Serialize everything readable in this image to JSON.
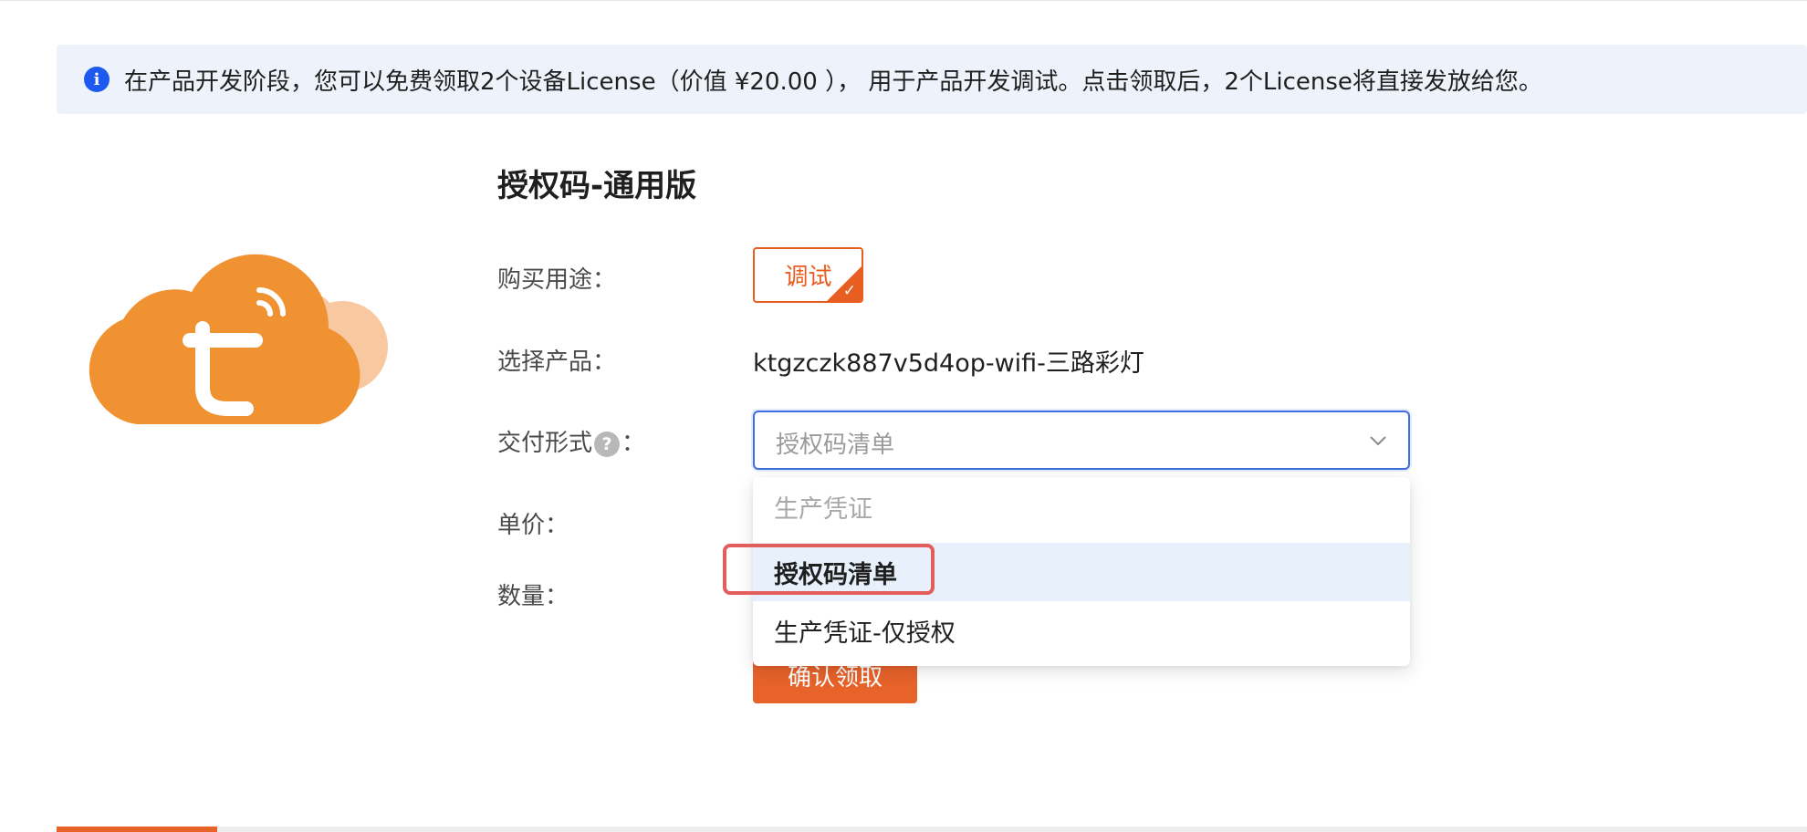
{
  "notice": {
    "icon": "info-icon",
    "text": "在产品开发阶段，您可以免费领取2个设备License（价值 ¥20.00 ）， 用于产品开发调试。点击领取后，2个License将直接发放给您。"
  },
  "logo": {
    "icon": "tuya-cloud-logo",
    "colors": {
      "primary": "#f09132",
      "secondary": "#f8c9a0"
    }
  },
  "product": {
    "title": "授权码-通用版"
  },
  "form": {
    "purpose_label": "购买用途：",
    "purpose_option": "调试",
    "product_label": "选择产品：",
    "product_value": "ktgzczk887v5d4op-wifi-三路彩灯",
    "delivery_label_prefix": "交付形式",
    "delivery_label_help": "?",
    "delivery_label_suffix": "：",
    "delivery_placeholder": "授权码清单",
    "price_label": "单价：",
    "quantity_label": "数量：",
    "confirm_label": "确认领取"
  },
  "dropdown": {
    "options": [
      {
        "label": "生产凭证",
        "state": "disabled"
      },
      {
        "label": "授权码清单",
        "state": "selected"
      },
      {
        "label": "生产凭证-仅授权",
        "state": "normal"
      }
    ]
  },
  "colors": {
    "accent": "#e8632a",
    "info": "#1f5af0",
    "focus": "#3f6fe0",
    "highlight": "#e35d5d"
  }
}
